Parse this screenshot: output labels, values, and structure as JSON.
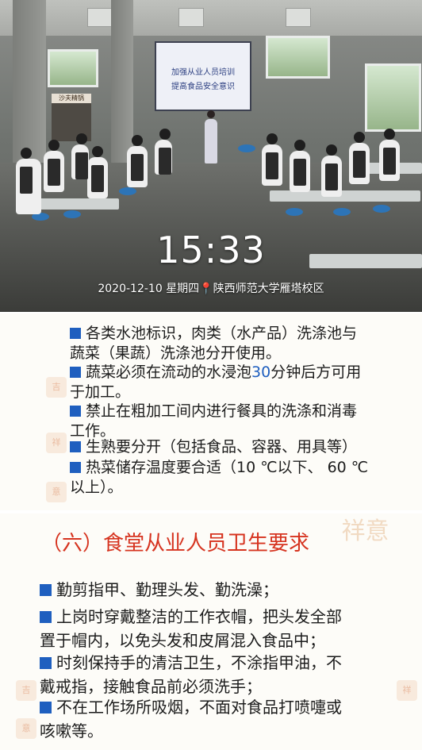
{
  "photo": {
    "screen_line1": "加强从业人员培训",
    "screen_line2": "提高食品安全意识",
    "shop_sign": "沙夫精锅",
    "time": "15:33",
    "date": "2020-12-10",
    "weekday": "星期四",
    "location": "陕西师范大学雁塔校区",
    "pin_icon": "location-pin-icon"
  },
  "slide1": {
    "items": [
      {
        "line1": "各类水池标识，肉类（水产品）洗涤池与",
        "line2": "蔬菜（果蔬）洗涤池分开使用。"
      },
      {
        "line1a": "蔬菜必须在流动的水浸泡",
        "line1num": "30",
        "line1b": "分钟后方可用",
        "line2": "于加工。"
      },
      {
        "line1": "禁止在粗加工间内进行餐具的洗涤和消毒",
        "line2": "工作。"
      },
      {
        "line1": "生熟要分开（包括食品、容器、用具等）",
        "line2": ""
      },
      {
        "line1": "热菜储存温度要合适（10 ℃以下、 60 ℃",
        "line2": "以上）。"
      }
    ]
  },
  "slide2": {
    "heading": "（六）食堂从业人员卫生要求",
    "decor": "祥意",
    "items": [
      {
        "line1": "勤剪指甲、勤理头发、勤洗澡；",
        "line2": ""
      },
      {
        "line1": "上岗时穿戴整洁的工作衣帽，把头发全部",
        "line2": "置于帽内，以免头发和皮屑混入食品中；"
      },
      {
        "line1": "时刻保持手的清洁卫生，不涂指甲油，不",
        "line2": "戴戒指，接触食品前必须洗手；"
      },
      {
        "line1": "不在工作场所吸烟，不面对食品打喷嚏或",
        "line2": "咳嗽等。"
      }
    ]
  },
  "colors": {
    "bullet_blue": "#1f5fbf",
    "heading_red": "#d6331f",
    "pin_red": "#e8322c"
  }
}
